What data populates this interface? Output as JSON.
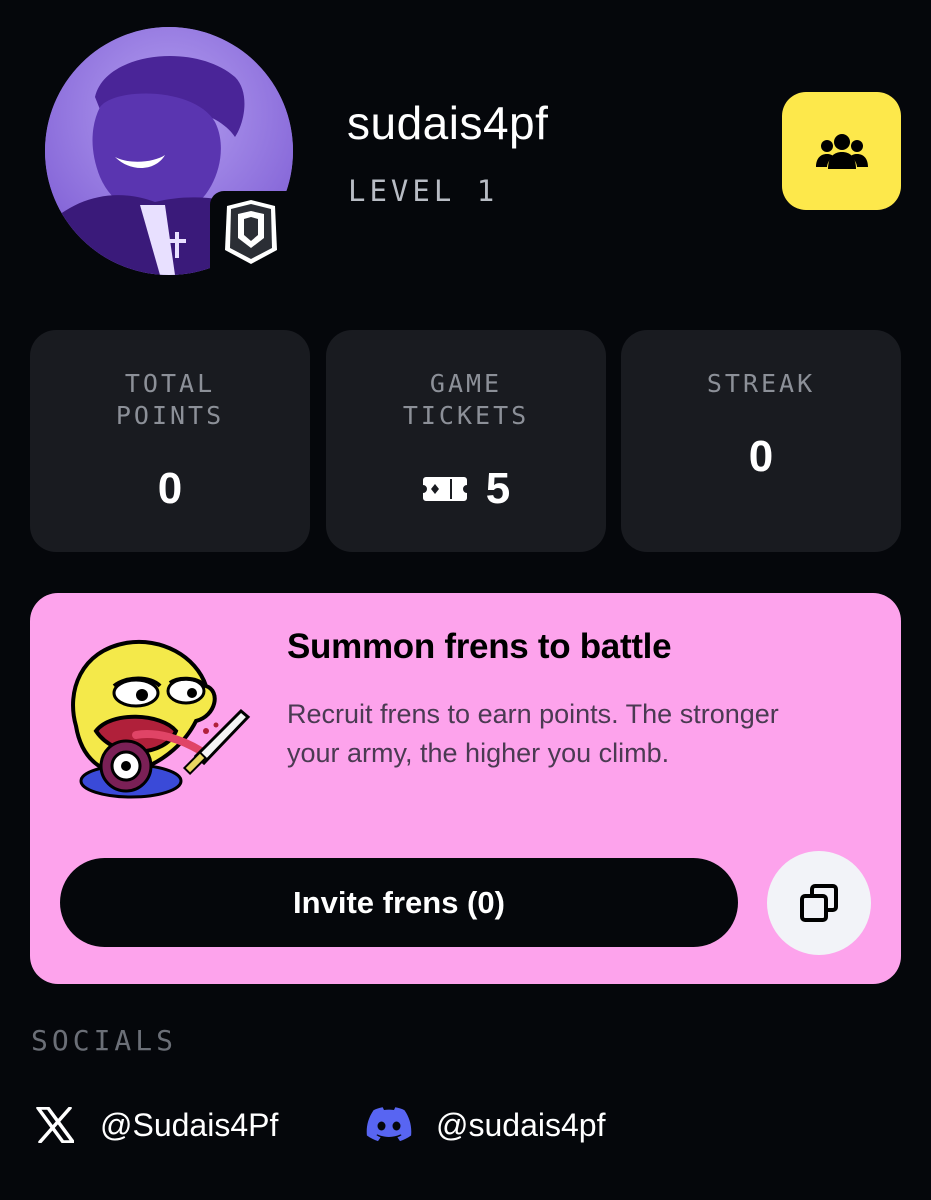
{
  "profile": {
    "username": "sudais4pf",
    "level_label": "LEVEL 1"
  },
  "stats": [
    {
      "label": "TOTAL\nPOINTS",
      "value": "0"
    },
    {
      "label": "GAME\nTICKETS",
      "value": "5",
      "icon": "ticket-icon"
    },
    {
      "label": "STREAK",
      "value": "0"
    }
  ],
  "summon": {
    "title": "Summon frens to battle",
    "description": "Recruit frens to earn points. The stronger your army, the higher you climb.",
    "invite_label": "Invite frens (0)"
  },
  "socials": {
    "label": "SOCIALS",
    "x_handle": "@Sudais4Pf",
    "discord_handle": "@sudais4pf"
  },
  "colors": {
    "background": "#05070b",
    "card": "#191b20",
    "accent_yellow": "#fde84b",
    "accent_pink": "#fda3ec",
    "discord_blue": "#5865f2"
  },
  "icons": {
    "frens": "group-icon",
    "rank": "shield-rank-icon",
    "copy": "copy-icon",
    "x": "x-logo-icon",
    "discord": "discord-icon"
  }
}
